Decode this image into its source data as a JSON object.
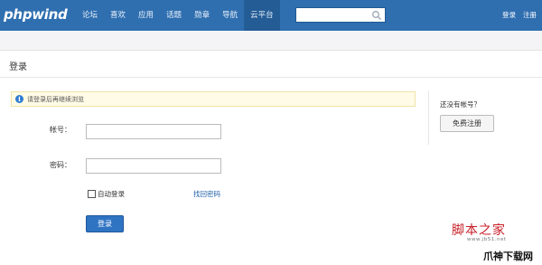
{
  "header": {
    "logo": "phpwind",
    "nav": [
      "论坛",
      "喜欢",
      "应用",
      "话题",
      "勋章",
      "导航",
      "云平台"
    ],
    "active_nav": "云平台",
    "search": {
      "value": "",
      "placeholder": ""
    },
    "links": {
      "login": "登录",
      "register": "注册"
    }
  },
  "panel": {
    "title": "登录",
    "notice": "请登录后再继续浏览",
    "account_label": "帐号：",
    "account_value": "",
    "password_label": "密码：",
    "password_value": "",
    "auto_login_label": "自动登录",
    "auto_login_checked": false,
    "forgot_label": "找回密码",
    "login_button": "登录"
  },
  "sidebar": {
    "question": "还没有帐号？",
    "register_button": "免费注册"
  },
  "watermark": {
    "brand": "脚本之家",
    "url": "www.jb51.net",
    "brand2": "爪神下载网"
  },
  "colors": {
    "topbar": "#2f6fb0",
    "active_nav": "#245c95",
    "button": "#2f74c3",
    "link": "#1f5fa8"
  }
}
